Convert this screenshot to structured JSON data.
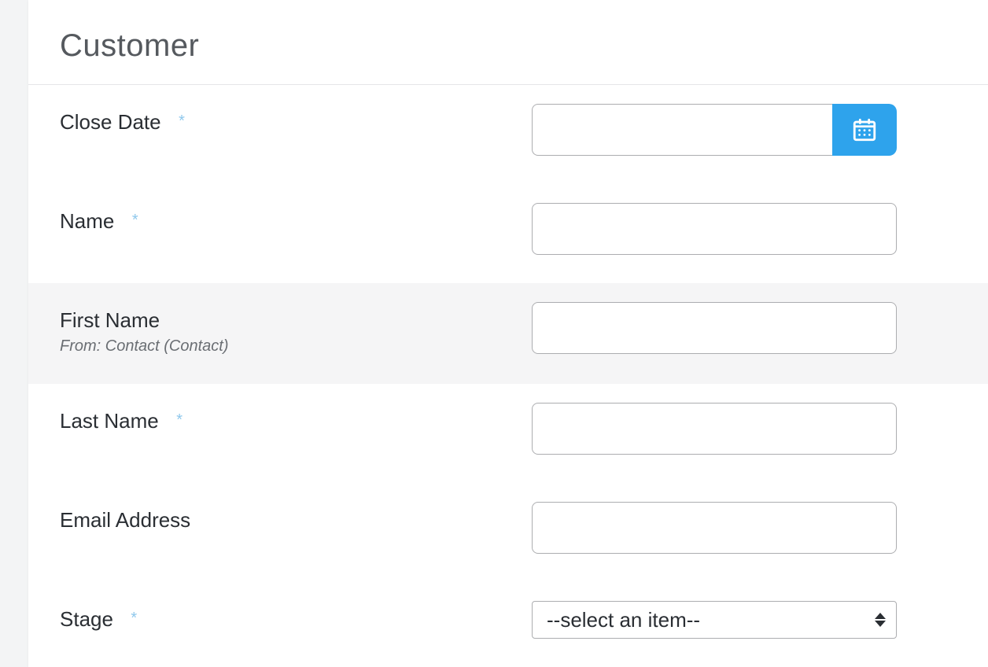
{
  "section": {
    "title": "Customer"
  },
  "required_mark": "*",
  "fields": {
    "close_date": {
      "label": "Close Date",
      "required": true,
      "value": ""
    },
    "name": {
      "label": "Name",
      "required": true,
      "value": ""
    },
    "first_name": {
      "label": "First Name",
      "sub": "From: Contact (Contact)",
      "required": false,
      "value": ""
    },
    "last_name": {
      "label": "Last Name",
      "required": true,
      "value": ""
    },
    "email": {
      "label": "Email Address",
      "required": false,
      "value": ""
    },
    "stage": {
      "label": "Stage",
      "required": true,
      "placeholder": "--select an item--"
    }
  }
}
